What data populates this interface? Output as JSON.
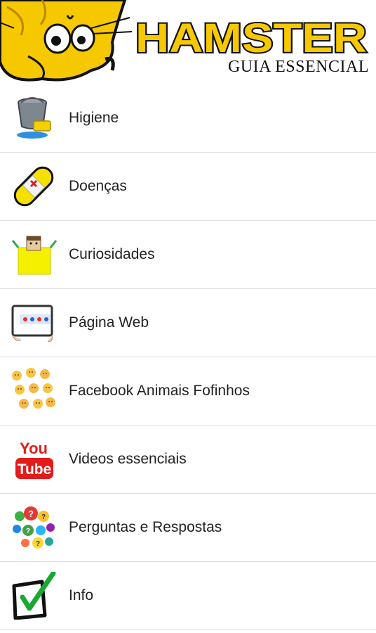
{
  "header": {
    "title": "HAMSTER",
    "subtitle": "GUIA ESSENCIAL",
    "title_color": "#F5C800"
  },
  "menu": {
    "items": [
      {
        "label": "Higiene",
        "icon": "bucket-sponge-icon"
      },
      {
        "label": "Doenças",
        "icon": "bandage-icon"
      },
      {
        "label": "Curiosidades",
        "icon": "surprise-box-icon"
      },
      {
        "label": "Página Web",
        "icon": "web-page-icon"
      },
      {
        "label": "Facebook Animais Fofinhos",
        "icon": "emoji-faces-icon"
      },
      {
        "label": "Videos essenciais",
        "icon": "youtube-icon"
      },
      {
        "label": "Perguntas e Respostas",
        "icon": "question-balls-icon"
      },
      {
        "label": "Info",
        "icon": "checkbox-check-icon"
      }
    ]
  }
}
